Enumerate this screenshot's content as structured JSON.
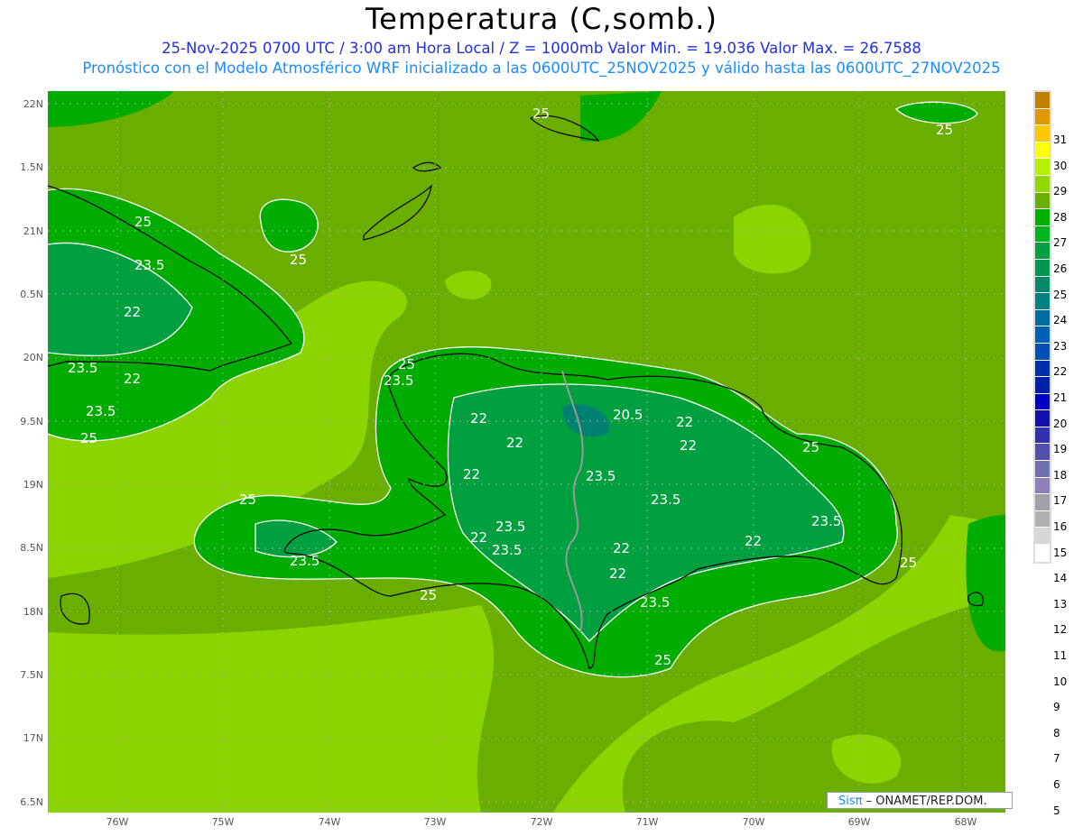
{
  "title": "Temperatura (C,somb.)",
  "subtitle1": "25-Nov-2025  0700 UTC / 3:00 am Hora Local / Z = 1000mb    Valor Min. = 19.036  Valor Max. = 26.7588",
  "subtitle2": "Pronóstico con el Modelo Atmosférico WRF inicializado a las 0600UTC_25NOV2025 y válido hasta las  0600UTC_27NOV2025",
  "lat_labels": [
    "22N",
    "1.5N",
    "21N",
    "0.5N",
    "20N",
    "9.5N",
    "19N",
    "8.5N",
    "18N",
    "7.5N",
    "17N",
    "6.5N"
  ],
  "lon_labels": [
    "76W",
    "75W",
    "74W",
    "73W",
    "72W",
    "71W",
    "70W",
    "69W",
    "68W"
  ],
  "colorbar": {
    "labels": [
      "31",
      "30",
      "29",
      "28",
      "27",
      "26",
      "25",
      "24",
      "23",
      "22",
      "21",
      "20",
      "19",
      "18",
      "17",
      "16",
      "15",
      "14",
      "13",
      "12",
      "11",
      "10",
      "9",
      "8",
      "7",
      "6",
      "5"
    ],
    "colors": [
      "#c08000",
      "#e09800",
      "#ffc800",
      "#ffff00",
      "#b4f000",
      "#90d800",
      "#6aae00",
      "#00b000",
      "#00b420",
      "#00a040",
      "#009650",
      "#008a6a",
      "#008080",
      "#006e9a",
      "#0060b4",
      "#0050b8",
      "#0030b0",
      "#0020a8",
      "#0000c0",
      "#1010b0",
      "#3030b0",
      "#5050aa",
      "#7070b0",
      "#9080b8",
      "#a0a0aa",
      "#b0b0b0",
      "#d6d6d6",
      "#ffffff"
    ]
  },
  "contour_labels": [
    "25",
    "25",
    "25",
    "23.5",
    "22",
    "23.5",
    "22",
    "23.5",
    "25",
    "25",
    "23.5",
    "25",
    "20.5",
    "22",
    "22",
    "22",
    "22",
    "22",
    "23.5",
    "23.5",
    "25",
    "23.5",
    "22",
    "22",
    "23.5",
    "22",
    "22",
    "23.5",
    "25",
    "25",
    "25",
    "23.5",
    "23.5",
    "25"
  ],
  "credit": {
    "brand": "Sisπ",
    "text": " –  ONAMET/REP.DOM."
  }
}
